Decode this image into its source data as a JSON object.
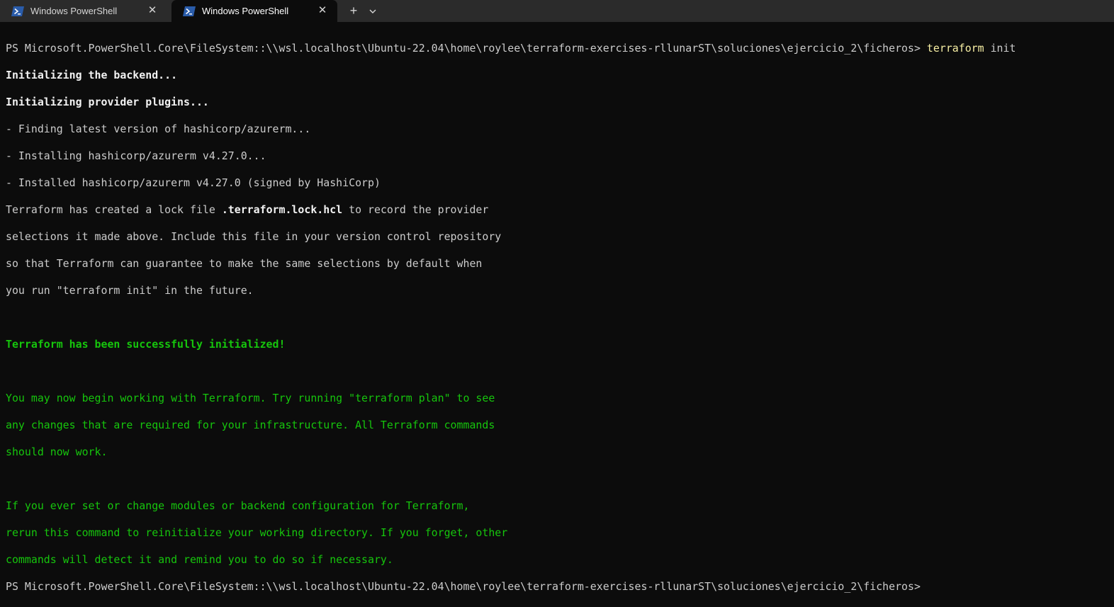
{
  "tabs": [
    {
      "label": "Windows PowerShell",
      "active": false
    },
    {
      "label": "Windows PowerShell",
      "active": true
    }
  ],
  "icons": {
    "tab_icon": "powershell-icon",
    "close": "close-icon",
    "new_tab": "plus-icon",
    "dropdown": "chevron-down-icon"
  },
  "colors": {
    "background": "#0c0c0c",
    "tabbar": "#2b2b2b",
    "text": "#cccccc",
    "success": "#16c60c",
    "command": "#f9f1a5"
  },
  "terminal": {
    "prompt": "PS Microsoft.PowerShell.Core\\FileSystem::\\\\wsl.localhost\\Ubuntu-22.04\\home\\roylee\\terraform-exercises-rllunarST\\soluciones\\ejercicio_2\\ficheros>",
    "command_name": "terraform",
    "command_args": " init",
    "init_backend": "Initializing the backend...",
    "init_plugins": "Initializing provider plugins...",
    "finding": "- Finding latest version of hashicorp/azurerm...",
    "installing": "- Installing hashicorp/azurerm v4.27.0...",
    "installed": "- Installed hashicorp/azurerm v4.27.0 (signed by HashiCorp)",
    "lock_prefix": "Terraform has created a lock file ",
    "lock_file": ".terraform.lock.hcl",
    "lock_suffix": " to record the provider",
    "lock_line2": "selections it made above. Include this file in your version control repository",
    "lock_line3": "so that Terraform can guarantee to make the same selections by default when",
    "lock_line4": "you run \"terraform init\" in the future.",
    "success": "Terraform has been successfully initialized!",
    "begin_line1": "You may now begin working with Terraform. Try running \"terraform plan\" to see",
    "begin_line2": "any changes that are required for your infrastructure. All Terraform commands",
    "begin_line3": "should now work.",
    "ever_line1": "If you ever set or change modules or backend configuration for Terraform,",
    "ever_line2": "rerun this command to reinitialize your working directory. If you forget, other",
    "ever_line3": "commands will detect it and remind you to do so if necessary."
  }
}
